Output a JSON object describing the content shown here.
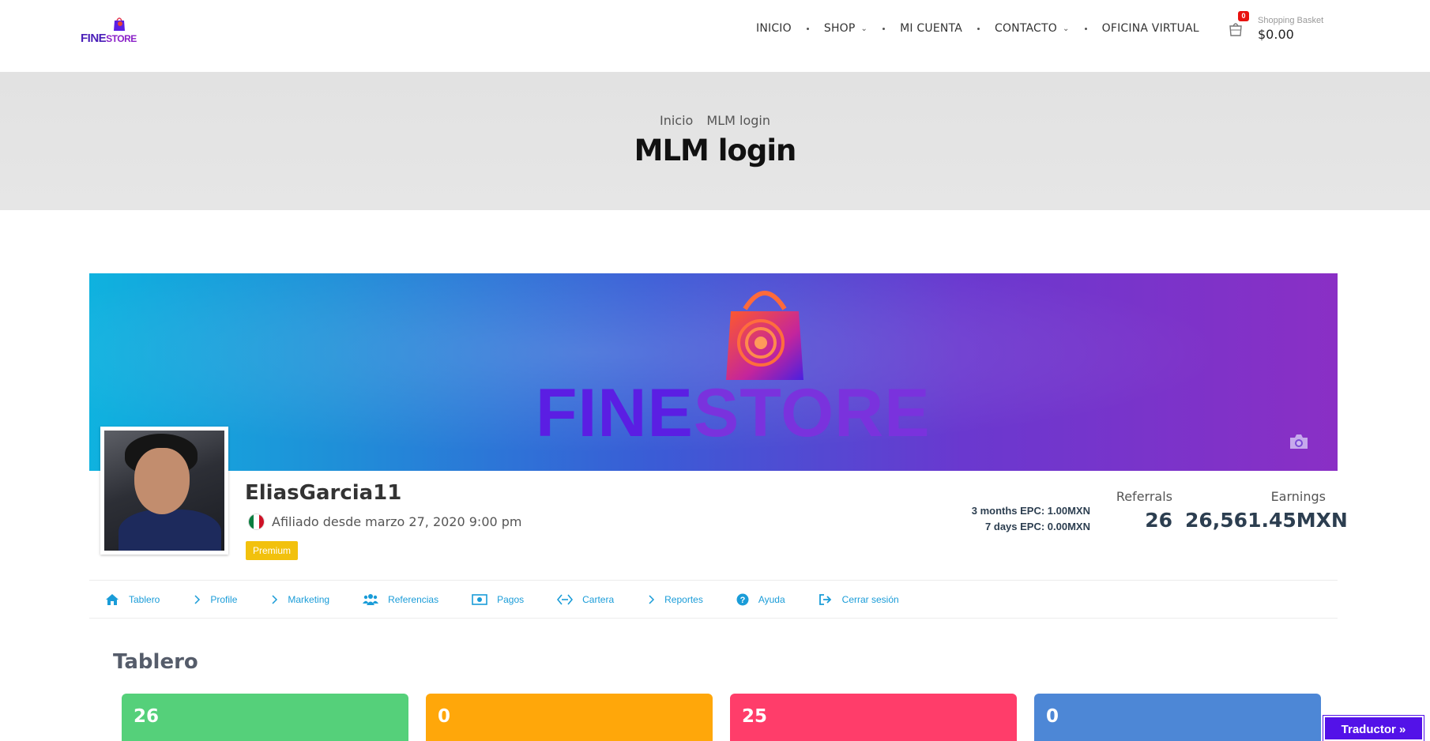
{
  "header": {
    "logo_text_main": "FINE",
    "logo_text_sub": "STORE",
    "nav": [
      {
        "label": "INICIO",
        "has_dropdown": false
      },
      {
        "label": "SHOP",
        "has_dropdown": true
      },
      {
        "label": "MI CUENTA",
        "has_dropdown": false
      },
      {
        "label": "CONTACTO",
        "has_dropdown": true
      },
      {
        "label": "OFICINA VIRTUAL",
        "has_dropdown": false
      }
    ],
    "cart": {
      "count": "0",
      "label": "Shopping Basket",
      "total": "$0.00"
    }
  },
  "banner": {
    "breadcrumb": [
      "Inicio",
      "MLM login"
    ],
    "title": "MLM login"
  },
  "cover": {
    "brand_a": "FINE",
    "brand_b": "STORE"
  },
  "profile": {
    "username": "EliasGarcia11",
    "joined": "Afiliado desde marzo 27, 2020 9:00 pm",
    "badge": "Premium",
    "epc_3_months": "3 months EPC: 1.00MXN",
    "epc_7_days": "7 days EPC: 0.00MXN",
    "referrals_label": "Referrals",
    "referrals_value": "26",
    "earnings_label": "Earnings",
    "earnings_value": "26,561.45MXN"
  },
  "profile_nav": [
    {
      "label": "Tablero",
      "icon": "home-icon"
    },
    {
      "label": "Profile",
      "icon": "chevron-right-icon"
    },
    {
      "label": "Marketing",
      "icon": "chevron-right-icon"
    },
    {
      "label": "Referencias",
      "icon": "users-icon"
    },
    {
      "label": "Pagos",
      "icon": "money-icon"
    },
    {
      "label": "Cartera",
      "icon": "wallet-icon"
    },
    {
      "label": "Reportes",
      "icon": "chevron-right-icon"
    },
    {
      "label": "Ayuda",
      "icon": "question-icon"
    },
    {
      "label": "Cerrar sesión",
      "icon": "logout-icon"
    }
  ],
  "dashboard": {
    "title": "Tablero",
    "cards": [
      {
        "value": "26",
        "color": "#55d07a"
      },
      {
        "value": "0",
        "color": "#ffa70a"
      },
      {
        "value": "25",
        "color": "#ff3d6a"
      },
      {
        "value": "0",
        "color": "#4d87d6"
      }
    ]
  },
  "translator": "Traductor »",
  "colors": {
    "link_blue": "#1a9cd8",
    "premium_yellow": "#f2c10d",
    "translator_purple": "#5312e8",
    "cart_badge_red": "#e8120f"
  }
}
